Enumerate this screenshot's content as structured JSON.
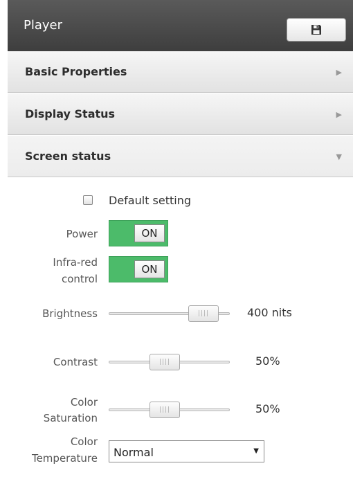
{
  "header": {
    "title": "Player",
    "save_icon": "floppy-disk-icon"
  },
  "sections": [
    {
      "title": "Basic Properties",
      "arrow": "▶",
      "expanded": false
    },
    {
      "title": "Display Status",
      "arrow": "▶",
      "expanded": false
    },
    {
      "title": "Screen status",
      "arrow": "▼",
      "expanded": true
    }
  ],
  "screen_status": {
    "default_setting": {
      "label": "Default setting",
      "checked": false
    },
    "power": {
      "label": "Power",
      "state": "ON"
    },
    "infrared": {
      "label_line1": "Infra-red",
      "label_line2": "control",
      "state": "ON"
    },
    "brightness": {
      "label": "Brightness",
      "value": "400 nits",
      "fraction": 0.83
    },
    "contrast": {
      "label": "Contrast",
      "value": "50%",
      "fraction": 0.5
    },
    "saturation": {
      "label_line1": "Color",
      "label_line2": "Saturation",
      "value": "50%",
      "fraction": 0.5
    },
    "temperature": {
      "label_line1": "Color",
      "label_line2": "Temperature",
      "selected": "Normal"
    }
  },
  "colors": {
    "toggle_on": "#4cbb6a",
    "header": "#4a4a4a"
  }
}
